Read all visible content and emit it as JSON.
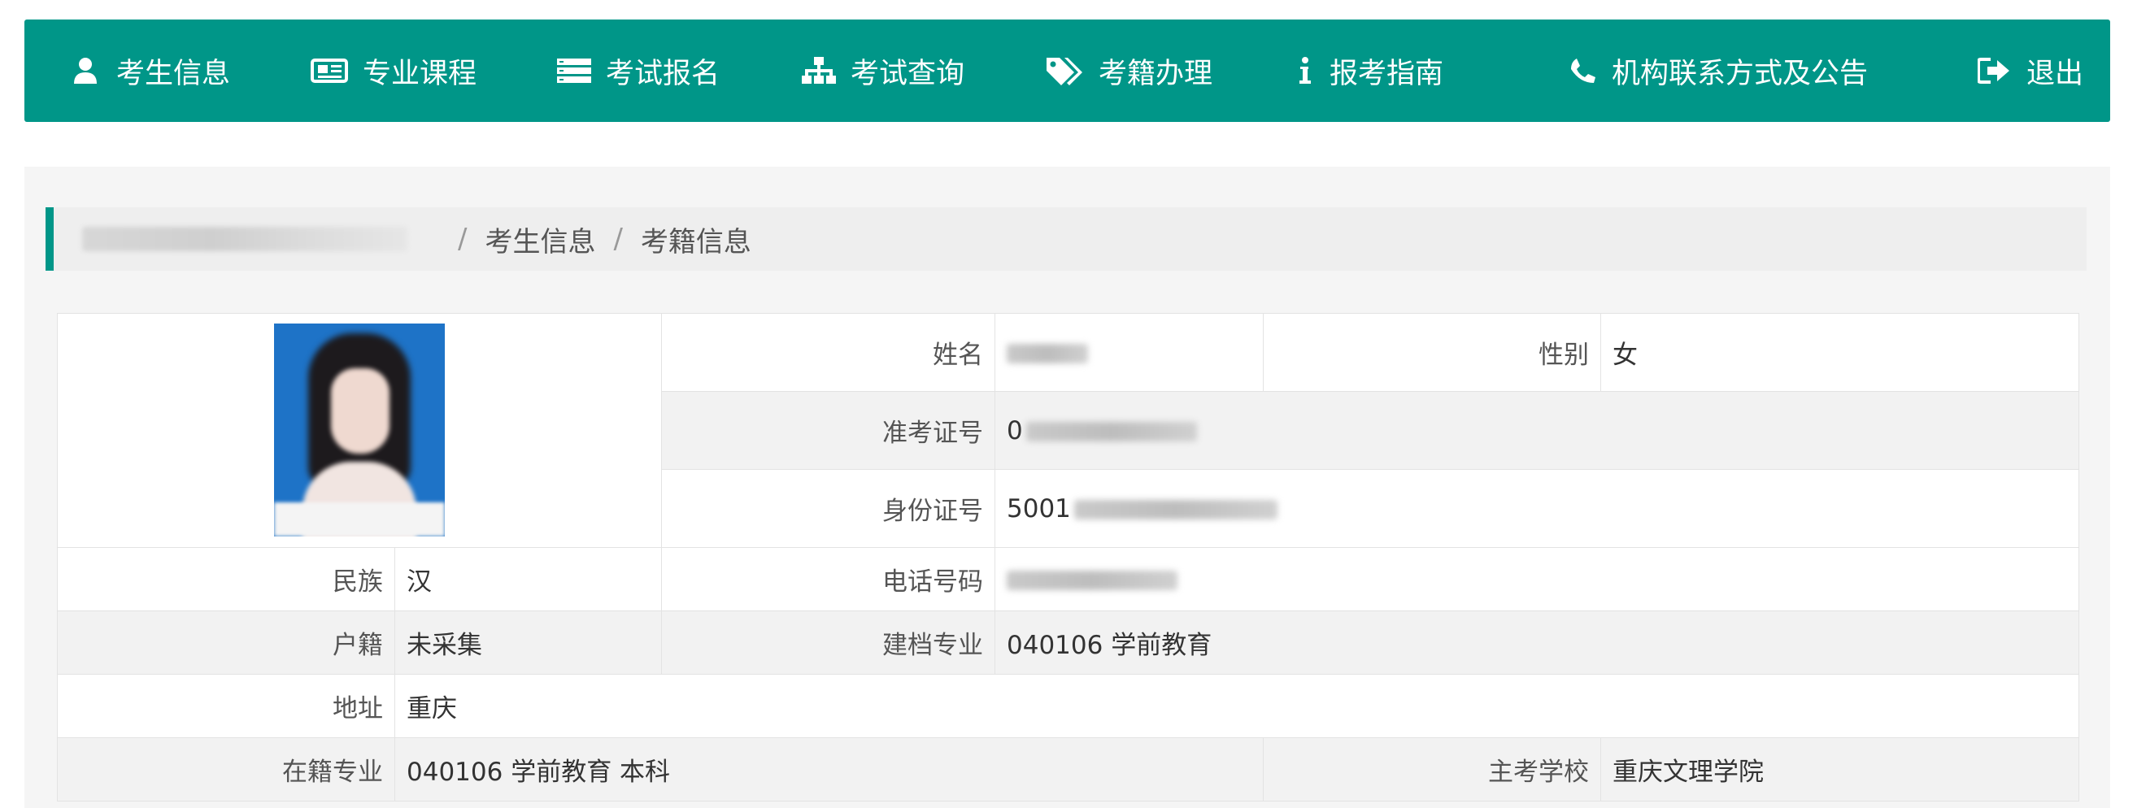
{
  "nav": {
    "items": [
      {
        "label": "考生信息",
        "icon": "user-icon"
      },
      {
        "label": "专业课程",
        "icon": "newspaper-icon"
      },
      {
        "label": "考试报名",
        "icon": "list-icon"
      },
      {
        "label": "考试查询",
        "icon": "sitemap-icon"
      },
      {
        "label": "考籍办理",
        "icon": "tags-icon"
      },
      {
        "label": "报考指南",
        "icon": "info-icon"
      },
      {
        "label": "机构联系方式及公告",
        "icon": "phone-icon"
      },
      {
        "label": "退出",
        "icon": "sign-out-icon"
      }
    ]
  },
  "breadcrumb": {
    "separator": "/",
    "items": [
      "考生信息",
      "考籍信息"
    ]
  },
  "info": {
    "name_label": "姓名",
    "gender_label": "性别",
    "gender_value": "女",
    "exam_no_label": "准考证号",
    "exam_no_value": "0",
    "id_no_label": "身份证号",
    "id_no_value": "5001",
    "ethnicity_label": "民族",
    "ethnicity_value": "汉",
    "phone_label": "电话号码",
    "household_label": "户籍",
    "household_value": "未采集",
    "file_major_label": "建档专业",
    "file_major_value": "040106 学前教育",
    "address_label": "地址",
    "address_value": "重庆",
    "enrolled_major_label": "在籍专业",
    "enrolled_major_value": "040106 学前教育 本科",
    "school_label": "主考学校",
    "school_value": "重庆文理学院"
  },
  "colors": {
    "nav_bg": "#009688",
    "accent": "#009688",
    "row_grey": "#f2f2f2"
  }
}
